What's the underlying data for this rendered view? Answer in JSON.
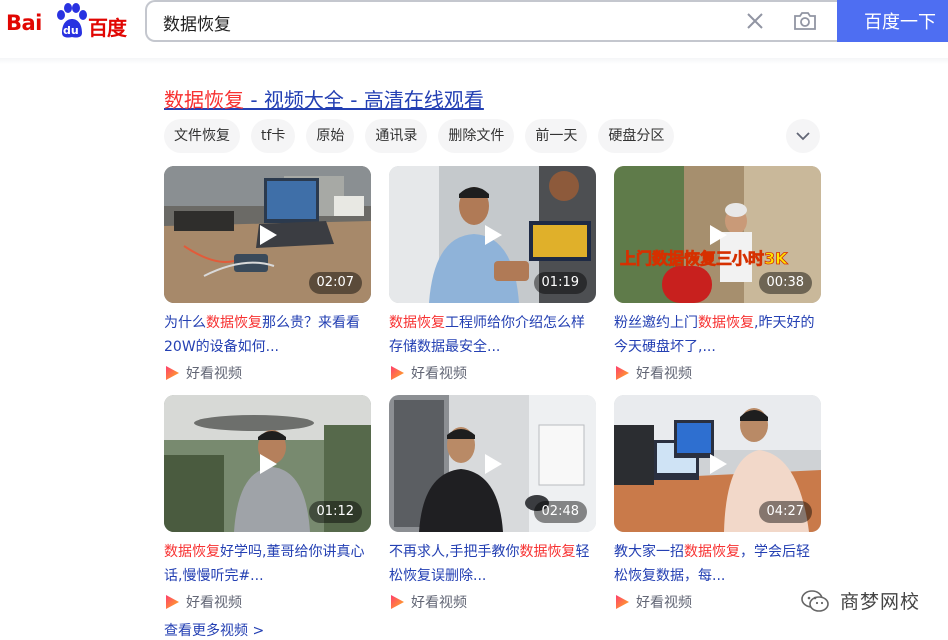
{
  "header": {
    "logo": {
      "latin": "Bai",
      "badge": "du",
      "chinese": "百度"
    },
    "search": {
      "value": "数据恢复"
    },
    "search_button_label": "百度一下",
    "brand_color": "#4e6ef2"
  },
  "result": {
    "title_highlight": "数据恢复",
    "title_rest": " - 视频大全 - 高清在线观看"
  },
  "chips": [
    "文件恢复",
    "tf卡",
    "原始",
    "通讯录",
    "删除文件",
    "前一天",
    "硬盘分区"
  ],
  "videos": [
    {
      "duration": "02:07",
      "title_pre": "为什么",
      "title_hl": "数据恢复",
      "title_post": "那么贵？来看看20W的设备如何...",
      "source": "好看视频"
    },
    {
      "duration": "01:19",
      "title_pre": "",
      "title_hl": "数据恢复",
      "title_post": "工程师给你介绍怎么样存储数据最安全...",
      "source": "好看视频"
    },
    {
      "duration": "00:38",
      "title_pre": "粉丝邀约上门",
      "title_hl": "数据恢复",
      "title_post": ",昨天好的今天硬盘坏了,...",
      "source": "好看视频",
      "overlay": "上门数据恢复三小时3K"
    },
    {
      "duration": "01:12",
      "title_pre": "",
      "title_hl": "数据恢复",
      "title_post": "好学吗,董哥给你讲真心话,慢慢听完#...",
      "source": "好看视频"
    },
    {
      "duration": "02:48",
      "title_pre": "不再求人,手把手教你",
      "title_hl": "数据恢复",
      "title_post": "轻松恢复误删除...",
      "source": "好看视频"
    },
    {
      "duration": "04:27",
      "title_pre": "教大家一招",
      "title_hl": "数据恢复",
      "title_post": "，学会后轻松恢复数据，每...",
      "source": "好看视频"
    }
  ],
  "more_link": "查看更多视频 >",
  "watermark": "商梦网校",
  "colors": {
    "link": "#2440b3",
    "highlight": "#f73131",
    "chip_bg": "#f5f5f6"
  }
}
